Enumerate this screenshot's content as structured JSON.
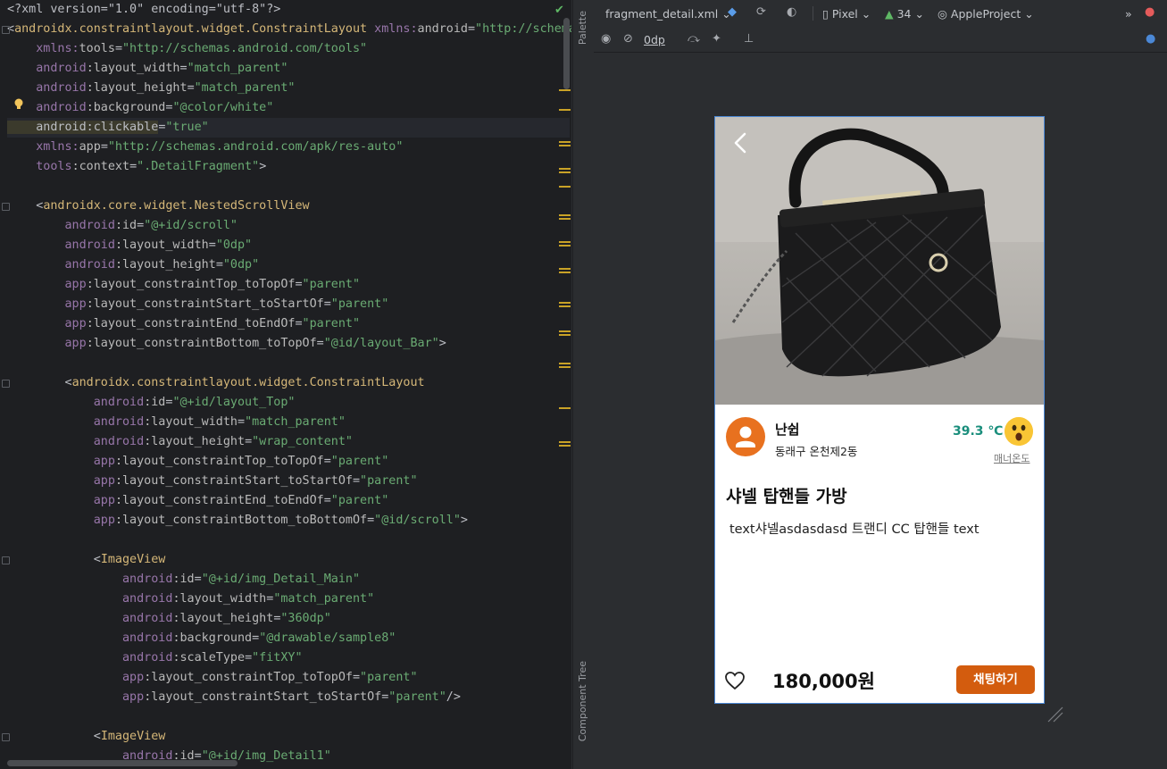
{
  "editor": {
    "lines": [
      [
        [
          "t-pi",
          "<?xml version=\"1.0\" encoding=\"utf-8\"?>"
        ]
      ],
      [
        [
          "t-pi",
          "<"
        ],
        [
          "t-tag",
          "androidx.constraintlayout.widget.ConstraintLayout"
        ],
        [
          "t-attr",
          " "
        ],
        [
          "t-ns",
          "xmlns:"
        ],
        [
          "t-attr",
          "android"
        ],
        [
          "t-pi",
          "="
        ],
        [
          "t-val",
          "\"http://schema"
        ]
      ],
      [
        [
          "t-attr",
          "    "
        ],
        [
          "t-ns",
          "xmlns:"
        ],
        [
          "t-attr",
          "tools"
        ],
        [
          "t-pi",
          "="
        ],
        [
          "t-val",
          "\"http://schemas.android.com/tools\""
        ]
      ],
      [
        [
          "t-attr",
          "    "
        ],
        [
          "t-ns",
          "android"
        ],
        [
          "t-attr",
          ":layout_width"
        ],
        [
          "t-pi",
          "="
        ],
        [
          "t-val",
          "\"match_parent\""
        ]
      ],
      [
        [
          "t-attr",
          "    "
        ],
        [
          "t-ns",
          "android"
        ],
        [
          "t-attr",
          ":layout_height"
        ],
        [
          "t-pi",
          "="
        ],
        [
          "t-val",
          "\"match_parent\""
        ]
      ],
      [
        [
          "t-attr",
          "    "
        ],
        [
          "t-ns",
          "android"
        ],
        [
          "t-attr",
          ":background"
        ],
        [
          "t-pi",
          "="
        ],
        [
          "t-val",
          "\"@color/white\""
        ]
      ],
      [
        [
          "t-hl",
          "    android:clickable"
        ],
        [
          "t-pi",
          "="
        ],
        [
          "t-val",
          "\"true\""
        ]
      ],
      [
        [
          "t-attr",
          "    "
        ],
        [
          "t-ns",
          "xmlns:"
        ],
        [
          "t-attr",
          "app"
        ],
        [
          "t-pi",
          "="
        ],
        [
          "t-val",
          "\"http://schemas.android.com/apk/res-auto\""
        ]
      ],
      [
        [
          "t-attr",
          "    "
        ],
        [
          "t-ns",
          "tools"
        ],
        [
          "t-attr",
          ":context"
        ],
        [
          "t-pi",
          "="
        ],
        [
          "t-val",
          "\".DetailFragment\""
        ],
        [
          "t-pi",
          ">"
        ]
      ],
      [
        [
          "t-attr",
          ""
        ]
      ],
      [
        [
          "t-attr",
          "    "
        ],
        [
          "t-pi",
          "<"
        ],
        [
          "t-tag",
          "androidx.core.widget.NestedScrollView"
        ]
      ],
      [
        [
          "t-attr",
          "        "
        ],
        [
          "t-ns",
          "android"
        ],
        [
          "t-attr",
          ":id"
        ],
        [
          "t-pi",
          "="
        ],
        [
          "t-val",
          "\"@+id/scroll\""
        ]
      ],
      [
        [
          "t-attr",
          "        "
        ],
        [
          "t-ns",
          "android"
        ],
        [
          "t-attr",
          ":layout_width"
        ],
        [
          "t-pi",
          "="
        ],
        [
          "t-val",
          "\"0dp\""
        ]
      ],
      [
        [
          "t-attr",
          "        "
        ],
        [
          "t-ns",
          "android"
        ],
        [
          "t-attr",
          ":layout_height"
        ],
        [
          "t-pi",
          "="
        ],
        [
          "t-val",
          "\"0dp\""
        ]
      ],
      [
        [
          "t-attr",
          "        "
        ],
        [
          "t-ns",
          "app"
        ],
        [
          "t-attr",
          ":layout_constraintTop_toTopOf"
        ],
        [
          "t-pi",
          "="
        ],
        [
          "t-val",
          "\"parent\""
        ]
      ],
      [
        [
          "t-attr",
          "        "
        ],
        [
          "t-ns",
          "app"
        ],
        [
          "t-attr",
          ":layout_constraintStart_toStartOf"
        ],
        [
          "t-pi",
          "="
        ],
        [
          "t-val",
          "\"parent\""
        ]
      ],
      [
        [
          "t-attr",
          "        "
        ],
        [
          "t-ns",
          "app"
        ],
        [
          "t-attr",
          ":layout_constraintEnd_toEndOf"
        ],
        [
          "t-pi",
          "="
        ],
        [
          "t-val",
          "\"parent\""
        ]
      ],
      [
        [
          "t-attr",
          "        "
        ],
        [
          "t-ns",
          "app"
        ],
        [
          "t-attr",
          ":layout_constraintBottom_toTopOf"
        ],
        [
          "t-pi",
          "="
        ],
        [
          "t-val",
          "\"@id/layout_Bar\""
        ],
        [
          "t-pi",
          ">"
        ]
      ],
      [
        [
          "t-attr",
          ""
        ]
      ],
      [
        [
          "t-attr",
          "        "
        ],
        [
          "t-pi",
          "<"
        ],
        [
          "t-tag",
          "androidx.constraintlayout.widget.ConstraintLayout"
        ]
      ],
      [
        [
          "t-attr",
          "            "
        ],
        [
          "t-ns",
          "android"
        ],
        [
          "t-attr",
          ":id"
        ],
        [
          "t-pi",
          "="
        ],
        [
          "t-val",
          "\"@+id/layout_Top\""
        ]
      ],
      [
        [
          "t-attr",
          "            "
        ],
        [
          "t-ns",
          "android"
        ],
        [
          "t-attr",
          ":layout_width"
        ],
        [
          "t-pi",
          "="
        ],
        [
          "t-val",
          "\"match_parent\""
        ]
      ],
      [
        [
          "t-attr",
          "            "
        ],
        [
          "t-ns",
          "android"
        ],
        [
          "t-attr",
          ":layout_height"
        ],
        [
          "t-pi",
          "="
        ],
        [
          "t-val",
          "\"wrap_content\""
        ]
      ],
      [
        [
          "t-attr",
          "            "
        ],
        [
          "t-ns",
          "app"
        ],
        [
          "t-attr",
          ":layout_constraintTop_toTopOf"
        ],
        [
          "t-pi",
          "="
        ],
        [
          "t-val",
          "\"parent\""
        ]
      ],
      [
        [
          "t-attr",
          "            "
        ],
        [
          "t-ns",
          "app"
        ],
        [
          "t-attr",
          ":layout_constraintStart_toStartOf"
        ],
        [
          "t-pi",
          "="
        ],
        [
          "t-val",
          "\"parent\""
        ]
      ],
      [
        [
          "t-attr",
          "            "
        ],
        [
          "t-ns",
          "app"
        ],
        [
          "t-attr",
          ":layout_constraintEnd_toEndOf"
        ],
        [
          "t-pi",
          "="
        ],
        [
          "t-val",
          "\"parent\""
        ]
      ],
      [
        [
          "t-attr",
          "            "
        ],
        [
          "t-ns",
          "app"
        ],
        [
          "t-attr",
          ":layout_constraintBottom_toBottomOf"
        ],
        [
          "t-pi",
          "="
        ],
        [
          "t-val",
          "\"@id/scroll\""
        ],
        [
          "t-pi",
          ">"
        ]
      ],
      [
        [
          "t-attr",
          ""
        ]
      ],
      [
        [
          "t-attr",
          "            "
        ],
        [
          "t-pi",
          "<"
        ],
        [
          "t-tag",
          "ImageView"
        ]
      ],
      [
        [
          "t-attr",
          "                "
        ],
        [
          "t-ns",
          "android"
        ],
        [
          "t-attr",
          ":id"
        ],
        [
          "t-pi",
          "="
        ],
        [
          "t-val",
          "\"@+id/img_Detail_Main\""
        ]
      ],
      [
        [
          "t-attr",
          "                "
        ],
        [
          "t-ns",
          "android"
        ],
        [
          "t-attr",
          ":layout_width"
        ],
        [
          "t-pi",
          "="
        ],
        [
          "t-val",
          "\"match_parent\""
        ]
      ],
      [
        [
          "t-attr",
          "                "
        ],
        [
          "t-ns",
          "android"
        ],
        [
          "t-attr",
          ":layout_height"
        ],
        [
          "t-pi",
          "="
        ],
        [
          "t-val",
          "\"360dp\""
        ]
      ],
      [
        [
          "t-attr",
          "                "
        ],
        [
          "t-ns",
          "android"
        ],
        [
          "t-attr",
          ":background"
        ],
        [
          "t-pi",
          "="
        ],
        [
          "t-val",
          "\"@drawable/sample8\""
        ]
      ],
      [
        [
          "t-attr",
          "                "
        ],
        [
          "t-ns",
          "android"
        ],
        [
          "t-attr",
          ":scaleType"
        ],
        [
          "t-pi",
          "="
        ],
        [
          "t-val",
          "\"fitXY\""
        ]
      ],
      [
        [
          "t-attr",
          "                "
        ],
        [
          "t-ns",
          "app"
        ],
        [
          "t-attr",
          ":layout_constraintTop_toTopOf"
        ],
        [
          "t-pi",
          "="
        ],
        [
          "t-val",
          "\"parent\""
        ]
      ],
      [
        [
          "t-attr",
          "                "
        ],
        [
          "t-ns",
          "app"
        ],
        [
          "t-attr",
          ":layout_constraintStart_toStartOf"
        ],
        [
          "t-pi",
          "="
        ],
        [
          "t-val",
          "\"parent\""
        ],
        [
          "t-pi",
          "/>"
        ]
      ],
      [
        [
          "t-attr",
          ""
        ]
      ],
      [
        [
          "t-attr",
          "            "
        ],
        [
          "t-pi",
          "<"
        ],
        [
          "t-tag",
          "ImageView"
        ]
      ],
      [
        [
          "t-attr",
          "                "
        ],
        [
          "t-ns",
          "android"
        ],
        [
          "t-attr",
          ":id"
        ],
        [
          "t-pi",
          "="
        ],
        [
          "t-val",
          "\"@+id/img_Detail1\""
        ]
      ]
    ]
  },
  "sidebar": {
    "palette_label": "Palette",
    "component_tree_label": "Component Tree"
  },
  "toolbar": {
    "file_name": "fragment_detail.xml",
    "device": "Pixel",
    "api": "34",
    "theme": "AppleProject",
    "overflow": "»",
    "margin_value": "0dp"
  },
  "preview": {
    "seller_name": "난쉽",
    "seller_region": "동래구 온천제2동",
    "temperature": "39.3 ℃",
    "manner_label": "매너온도",
    "title": "샤넬 탑핸들 가방",
    "description": "text샤넬asdasdasd 트랜디 CC 탑핸들 text",
    "price": "180,000원",
    "chat_button": "채팅하기"
  },
  "colors": {
    "accent_orange": "#d35c0e",
    "avatar_orange": "#e8711f",
    "temp_green": "#1a8e7c",
    "selection_blue": "#4b88d6"
  }
}
